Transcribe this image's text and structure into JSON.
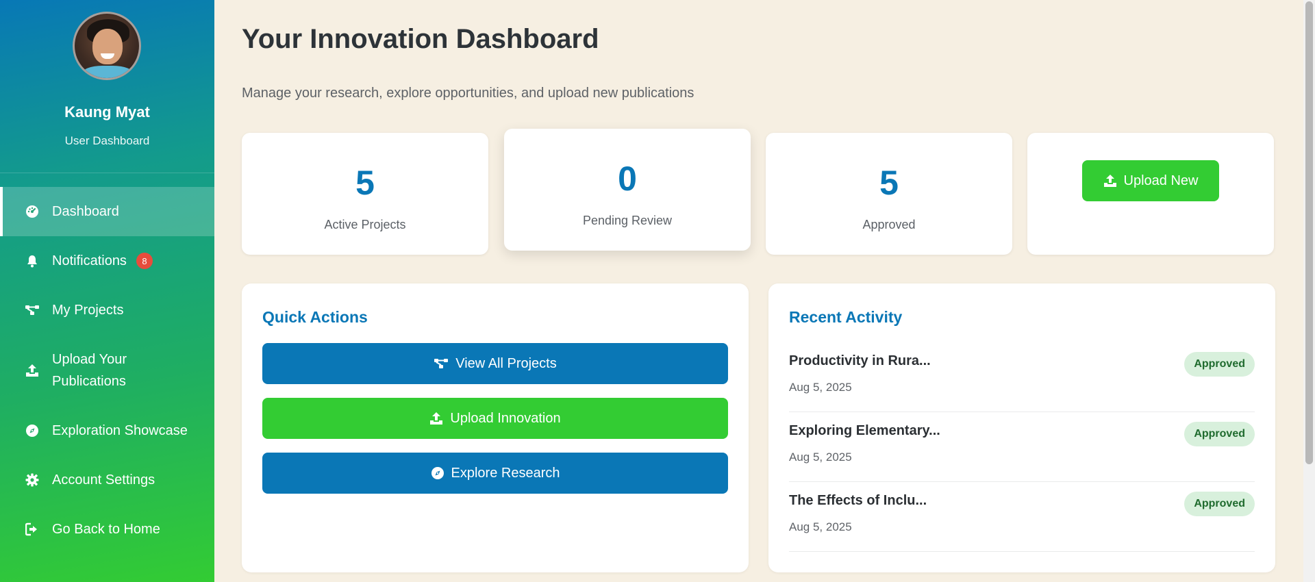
{
  "sidebar": {
    "profile": {
      "name": "Kaung Myat",
      "role": "User Dashboard"
    },
    "items": [
      {
        "label": "Dashboard",
        "icon": "gauge-icon"
      },
      {
        "label": "Notifications",
        "icon": "bell-icon",
        "badge": "8"
      },
      {
        "label": "My Projects",
        "icon": "project-diagram-icon"
      },
      {
        "label": "Upload Your Publications",
        "icon": "upload-icon"
      },
      {
        "label": "Exploration Showcase",
        "icon": "compass-icon"
      },
      {
        "label": "Account Settings",
        "icon": "gear-icon"
      },
      {
        "label": "Go Back to Home",
        "icon": "sign-out-icon"
      }
    ]
  },
  "header": {
    "title": "Your Innovation Dashboard",
    "subtitle": "Manage your research, explore opportunities, and upload new publications"
  },
  "stats": [
    {
      "value": "5",
      "label": "Active Projects"
    },
    {
      "value": "0",
      "label": "Pending Review"
    },
    {
      "value": "5",
      "label": "Approved"
    }
  ],
  "upload_new": {
    "label": "Upload New",
    "icon": "upload-icon"
  },
  "quick_actions": {
    "title": "Quick Actions",
    "buttons": [
      {
        "label": "View All Projects",
        "icon": "project-diagram-icon",
        "color": "#0a77b6"
      },
      {
        "label": "Upload Innovation",
        "icon": "upload-icon",
        "color": "#33cc33"
      },
      {
        "label": "Explore Research",
        "icon": "compass-icon",
        "color": "#0a77b6"
      }
    ]
  },
  "recent_activity": {
    "title": "Recent Activity",
    "items": [
      {
        "title": "Productivity in Rura...",
        "date": "Aug 5, 2025",
        "status": "Approved"
      },
      {
        "title": "Exploring Elementary...",
        "date": "Aug 5, 2025",
        "status": "Approved"
      },
      {
        "title": "The Effects of Inclu...",
        "date": "Aug 5, 2025",
        "status": "Approved"
      }
    ]
  },
  "colors": {
    "primary": "#0a77b6",
    "success": "#33cc33",
    "badge": "#e74c3c",
    "background": "#f6efe2"
  }
}
